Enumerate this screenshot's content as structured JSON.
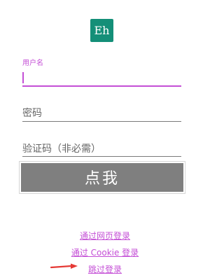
{
  "app": {
    "logo_text": "Eh",
    "brand_color": "#148f78",
    "accent_color": "#c44fd6"
  },
  "form": {
    "username": {
      "label": "用户名",
      "value": ""
    },
    "password": {
      "placeholder": "密码",
      "value": ""
    },
    "captcha": {
      "placeholder": "验证码（非必需）",
      "value": ""
    },
    "submit_label": "点我"
  },
  "links": {
    "web_login": "通过网页登录",
    "cookie_login": "通过 Cookie 登录",
    "skip_login": "跳过登录"
  },
  "annotation": {
    "arrow_color": "#e53935",
    "arrow_icon": "red-arrow-icon"
  }
}
